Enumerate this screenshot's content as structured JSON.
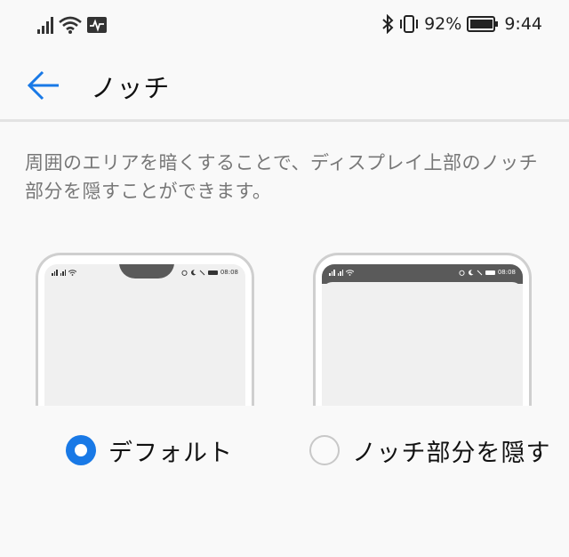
{
  "status_bar": {
    "battery_percent": "92%",
    "time": "9:44"
  },
  "header": {
    "title": "ノッチ"
  },
  "description": "周囲のエリアを暗くすることで、ディスプレイ上部のノッチ部分を隠すことができます。",
  "preview": {
    "time": "08:08"
  },
  "options": [
    {
      "label": "デフォルト",
      "selected": true
    },
    {
      "label": "ノッチ部分を隠す",
      "selected": false
    }
  ],
  "colors": {
    "accent": "#1979e6",
    "background": "#f9f9f9",
    "text_secondary": "#777777",
    "notch": "#5a5a5a"
  },
  "icons": {
    "back": "arrow-left-icon",
    "signal": "signal-icon",
    "wifi": "wifi-icon",
    "activity": "activity-icon",
    "bluetooth": "bluetooth-icon",
    "vibrate": "vibrate-icon",
    "battery": "battery-icon"
  }
}
